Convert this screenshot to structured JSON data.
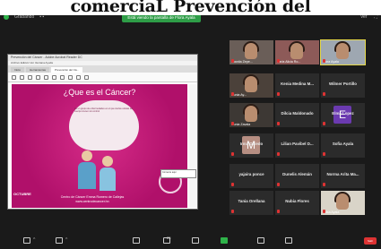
{
  "overlay_title": "comerciaL Prevención del",
  "topbar": {
    "meeting_label": "Grabando",
    "share_banner": "Está viendo la pantalla de Flora Ayala",
    "view_label": "Ver",
    "close_label": "X"
  },
  "shared": {
    "window_title": "Prevención del Cáncer - Adobe Acrobat Reader DC",
    "menu": "Archivo  Edición  Ver  Ventana  Ayuda",
    "tabs": [
      "Inicio",
      "Herramientas",
      "Prevención del Cá..."
    ],
    "slide_title": "¿Que es el Cáncer?",
    "cloud_text": "Es un grupo de enfermedades en el que ciertas células del cuerpo crecen sin control",
    "logo_left": "OCTUBRE",
    "footer_line1": "Centro de Cáncer Emma Romero de Callejas",
    "footer_line2": "www.centrodecancer.hn",
    "tooltip": "Comente aquí"
  },
  "participants": [
    {
      "name": "Juanita Zepe...",
      "video": true,
      "color": "#6a5e58"
    },
    {
      "name": "Karla Alicia Ro...",
      "video": true,
      "color": "#8d5a58"
    },
    {
      "name": "Flora Ayala",
      "video": true,
      "color": "#9ea7b1"
    },
    {
      "name": "Dunia Ay...",
      "video": true,
      "color": "#4b413a"
    },
    {
      "name": "Kenia Medina M...",
      "video": false
    },
    {
      "name": "Wilmer Portillo",
      "video": false
    },
    {
      "name": "Dunia Zavala",
      "video": true,
      "color": "#3d3834"
    },
    {
      "name": "Dilcia Maldonado",
      "video": false
    },
    {
      "name": "Elma Lopez",
      "video": false,
      "avatar": "E",
      "avatar_color": "#6b3ab0"
    },
    {
      "name": "Irma Oviedo",
      "video": false,
      "avatar": "M",
      "avatar_color": "#b68e82"
    },
    {
      "name": "Lilian Pavibel D...",
      "video": false
    },
    {
      "name": "Sofia Ayala",
      "video": false
    },
    {
      "name": "yajaira ponce",
      "video": false
    },
    {
      "name": "Dunelis Alemán",
      "video": false
    },
    {
      "name": "Norma Arita Ma...",
      "video": false
    },
    {
      "name": "Tania Orellana",
      "video": false
    },
    {
      "name": "Nubia Flores",
      "video": false
    },
    {
      "name": "Luisa Ayala",
      "video": true,
      "color": "#d9d4c8"
    }
  ],
  "bottombar": {
    "participants_count": "25",
    "end_label": "Salir"
  }
}
